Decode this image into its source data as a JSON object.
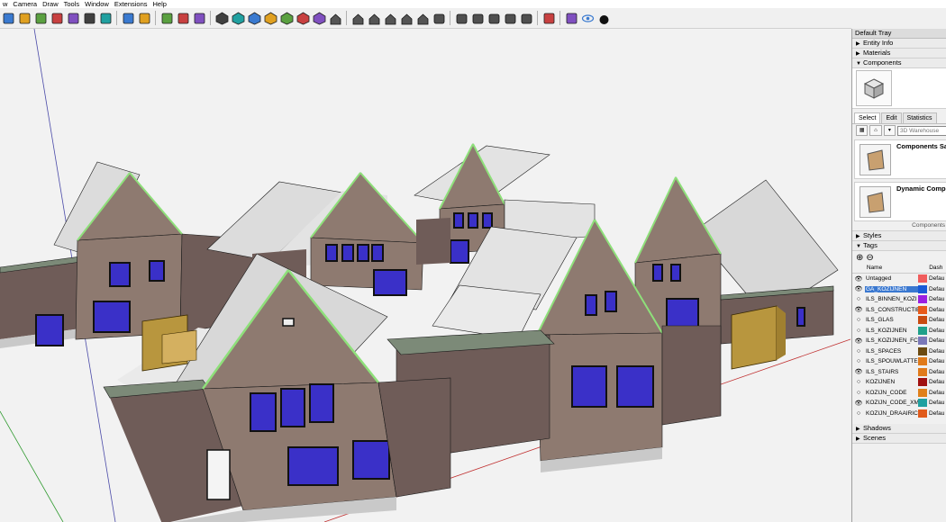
{
  "menu": [
    "w",
    "Camera",
    "Draw",
    "Tools",
    "Window",
    "Extensions",
    "Help"
  ],
  "toolbar_icons": [
    "walk-icon",
    "tape-measure-icon",
    "section-plane-icon",
    "component-browser-icon",
    "open-folder-icon",
    "photo-icon",
    "layer-icon",
    "outliner-icon",
    "stack-icon",
    "zoom-extents-icon",
    "magnify-icon",
    "sort-icon",
    "xray-icon",
    "back-edges-icon",
    "wireframe-icon",
    "hidden-line-icon",
    "shaded-icon",
    "textured-icon",
    "monochrome-icon",
    "iso-view-icon",
    "top-view-icon",
    "front-view-icon",
    "right-view-icon",
    "back-view-icon",
    "left-view-icon",
    "section-cut-icon",
    "solid-union-icon",
    "solid-subtract-icon",
    "solid-trim-icon",
    "solid-split-icon",
    "solid-outer-icon",
    "folder-icon",
    "move-icon",
    "eye-icon",
    "bomb-icon"
  ],
  "tray": {
    "title": "Default Tray",
    "panels_top": [
      {
        "label": "Entity Info",
        "arrow": "▶"
      },
      {
        "label": "Materials",
        "arrow": "▶"
      },
      {
        "label": "Components",
        "arrow": "▼"
      }
    ],
    "tabs": [
      "Select",
      "Edit",
      "Statistics"
    ],
    "warehouse_search": "3D Warehouse",
    "component_items": [
      {
        "title": "Components Sam"
      },
      {
        "title": "Dynamic Compor"
      }
    ],
    "components_footer": "Components",
    "panels_mid": [
      {
        "label": "Styles",
        "arrow": "▶"
      },
      {
        "label": "Tags",
        "arrow": "▼"
      }
    ],
    "tag_headers": {
      "name": "Name",
      "dash": "Dash"
    },
    "tags": [
      {
        "visible": "👁",
        "name": "Untagged",
        "color": "#f05c5c",
        "dash": "Defau",
        "selected": false
      },
      {
        "visible": "👁",
        "name": "GA_KOZIJNEN",
        "color": "#1a5ad7",
        "dash": "Defau",
        "selected": true
      },
      {
        "visible": "○",
        "name": "ILS_BINNEN_KOZI",
        "color": "#9b1fe0",
        "dash": "Defau",
        "selected": false
      },
      {
        "visible": "👁",
        "name": "ILS_CONSTRUCTIE",
        "color": "#e85a1a",
        "dash": "Defau",
        "selected": false
      },
      {
        "visible": "○",
        "name": "ILS_GLAS",
        "color": "#c84a10",
        "dash": "Defau",
        "selected": false
      },
      {
        "visible": "○",
        "name": "ILS_KOZIJNEN",
        "color": "#1fa08a",
        "dash": "Defau",
        "selected": false
      },
      {
        "visible": "👁",
        "name": "ILS_KOZIJNEN_FC",
        "color": "#7a78b8",
        "dash": "Defau",
        "selected": false
      },
      {
        "visible": "○",
        "name": "ILS_SPACES",
        "color": "#6b4a10",
        "dash": "Defau",
        "selected": false
      },
      {
        "visible": "○",
        "name": "ILS_SPOUWLATTE",
        "color": "#e07a1a",
        "dash": "Defau",
        "selected": false
      },
      {
        "visible": "👁",
        "name": "ILS_STAIRS",
        "color": "#e07a1a",
        "dash": "Defau",
        "selected": false
      },
      {
        "visible": "○",
        "name": "KOZIJNEN",
        "color": "#a01010",
        "dash": "Defau",
        "selected": false
      },
      {
        "visible": "○",
        "name": "KOZIJN_CODE",
        "color": "#e0801a",
        "dash": "Defau",
        "selected": false
      },
      {
        "visible": "👁",
        "name": "KOZIJN_CODE_XM",
        "color": "#1fa0a0",
        "dash": "Defau",
        "selected": false
      },
      {
        "visible": "○",
        "name": "KOZIJN_DRAAIRIC",
        "color": "#e05a1a",
        "dash": "Defau",
        "selected": false
      }
    ],
    "panels_bottom": [
      {
        "label": "Shadows",
        "arrow": "▶"
      },
      {
        "label": "Scenes",
        "arrow": "▶"
      }
    ]
  }
}
